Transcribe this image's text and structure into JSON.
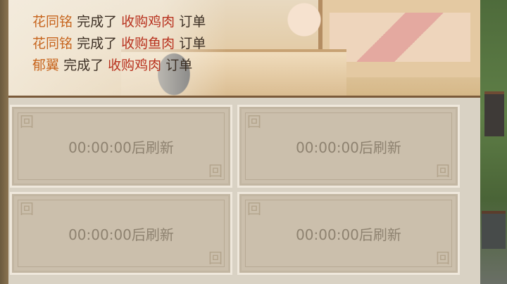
{
  "order_log": [
    {
      "name": "花同铭",
      "verb": "完成了",
      "order": "收购鸡肉",
      "suffix": "订单"
    },
    {
      "name": "花同铭",
      "verb": "完成了",
      "order": "收购鱼肉",
      "suffix": "订单"
    },
    {
      "name": "郁翼",
      "verb": "完成了",
      "order": "收购鸡肉",
      "suffix": "订单"
    }
  ],
  "slots": [
    {
      "timer": "00:00:00后刷新"
    },
    {
      "timer": "00:00:00后刷新"
    },
    {
      "timer": "00:00:00后刷新"
    },
    {
      "timer": "00:00:00后刷新"
    }
  ],
  "colors": {
    "name": "#c7651e",
    "order": "#b8321f",
    "text": "#3c2f24",
    "slot_bg": "#cbbfac",
    "timer_text": "#8e8270"
  },
  "icons": [
    "meander-corner-icon"
  ]
}
